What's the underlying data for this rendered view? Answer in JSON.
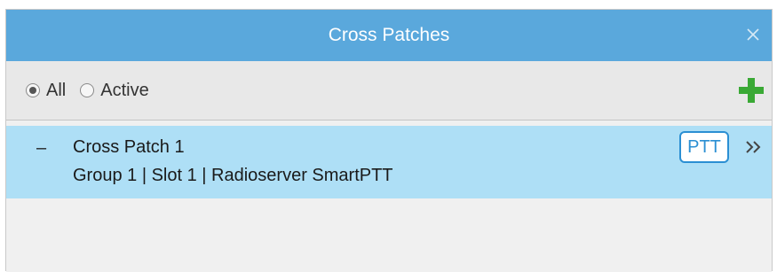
{
  "window": {
    "title": "Cross Patches"
  },
  "filter": {
    "options": [
      {
        "label": "All",
        "selected": true
      },
      {
        "label": "Active",
        "selected": false
      }
    ]
  },
  "patches": [
    {
      "name": "Cross Patch 1",
      "members": "Group 1 | Slot 1 | Radioserver SmartPTT",
      "ptt_label": "PTT",
      "expanded": true,
      "collapse_glyph": "–"
    }
  ],
  "icons": {
    "close": "close-icon",
    "add": "plus-icon",
    "expand": "double-chevron-right-icon"
  },
  "colors": {
    "titlebar": "#5aa8dc",
    "selected_row": "#aedff6",
    "ptt_accent": "#2b8fd3",
    "add_green": "#3aa935"
  }
}
